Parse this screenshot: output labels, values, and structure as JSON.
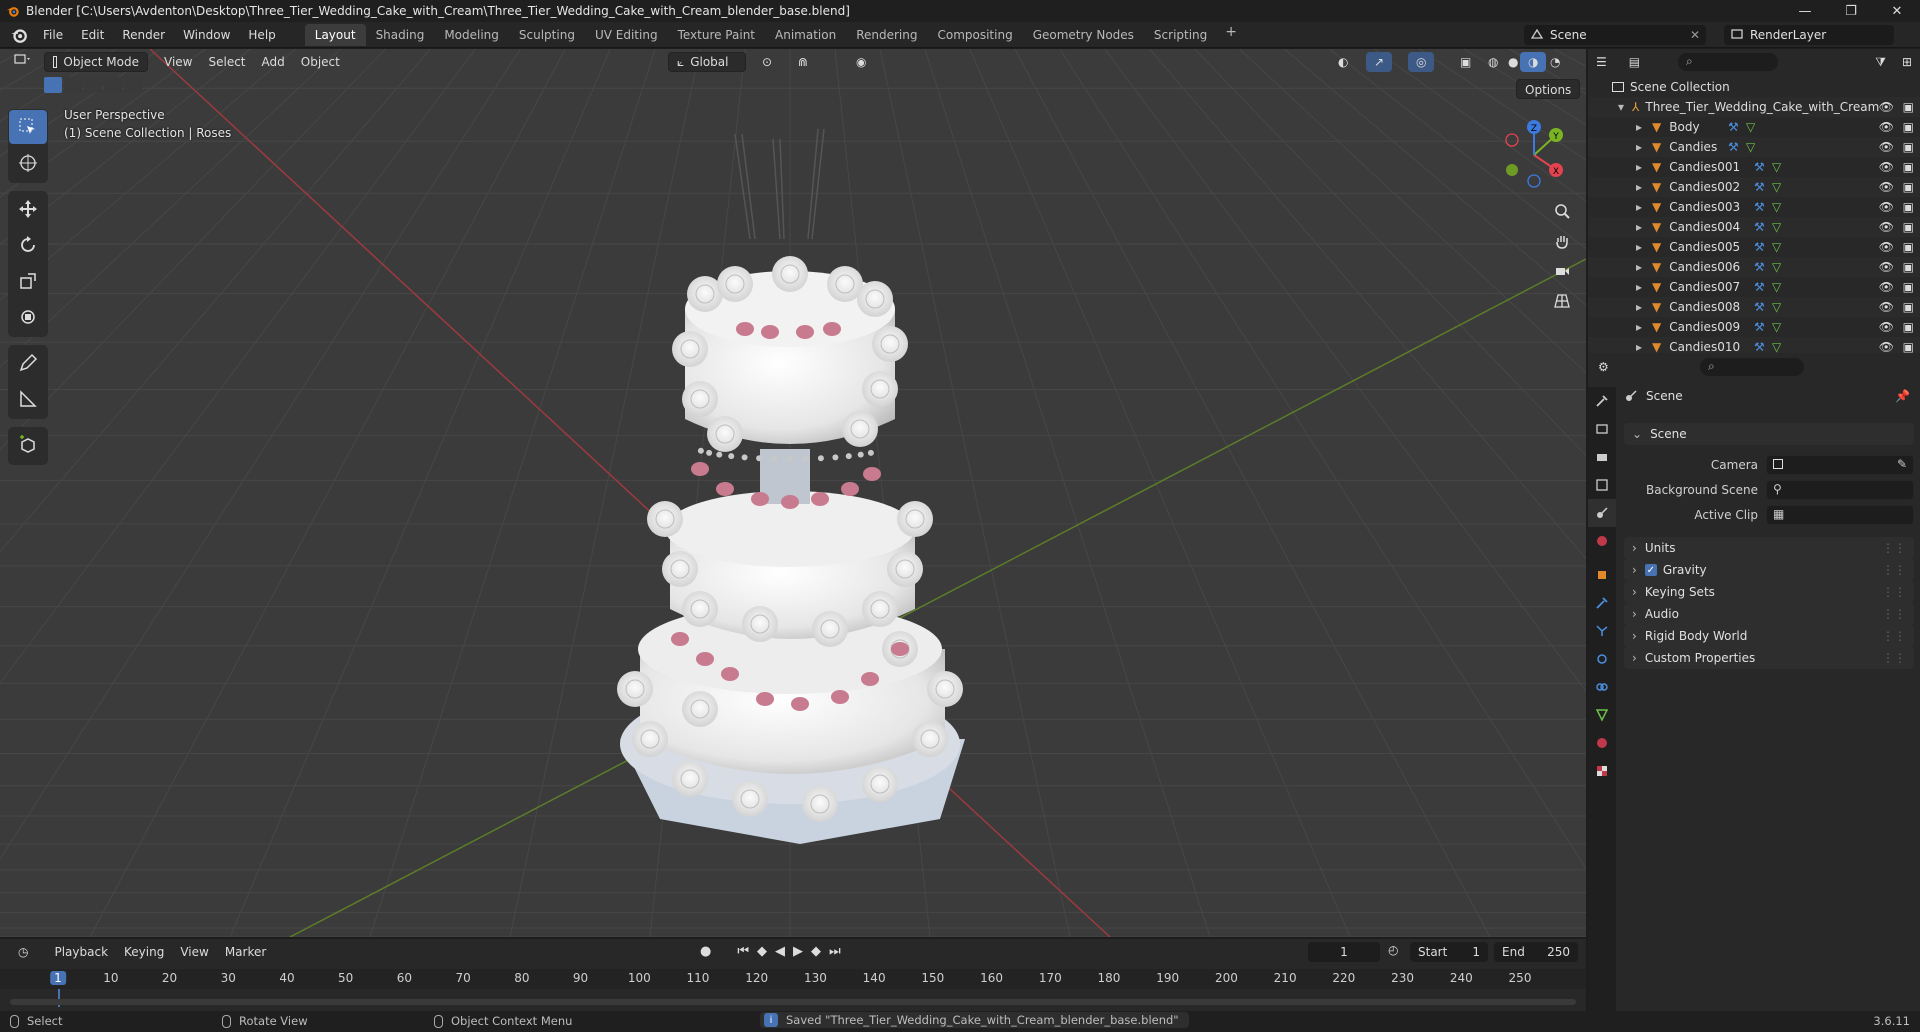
{
  "window": {
    "title": "Blender [C:\\Users\\Avdenton\\Desktop\\Three_Tier_Wedding_Cake_with_Cream\\Three_Tier_Wedding_Cake_with_Cream_blender_base.blend]",
    "controls": [
      "—",
      "❐",
      "✕"
    ]
  },
  "menu": [
    "File",
    "Edit",
    "Render",
    "Window",
    "Help"
  ],
  "workspaces": {
    "tabs": [
      "Layout",
      "Shading",
      "Modeling",
      "Sculpting",
      "UV Editing",
      "Texture Paint",
      "Animation",
      "Rendering",
      "Compositing",
      "Geometry Nodes",
      "Scripting"
    ],
    "active": "Layout",
    "add": "+"
  },
  "scene_selector": {
    "scene": "Scene",
    "view_layer": "RenderLayer"
  },
  "viewport": {
    "mode": "Object Mode",
    "menus": [
      "View",
      "Select",
      "Add",
      "Object"
    ],
    "orientation": "Global",
    "options_label": "Options",
    "overlay_line1": "User Perspective",
    "overlay_line2": "(1) Scene Collection | Roses",
    "gizmo_axes": {
      "x": "X",
      "y": "Y",
      "z": "Z"
    },
    "colors": {
      "x_axis": "#e2434f",
      "y_axis": "#7bb422",
      "z_axis": "#3d7ae0",
      "active_tool": "#4772b3"
    }
  },
  "outliner": {
    "root": "Scene Collection",
    "collection": "Three_Tier_Wedding_Cake_with_Cream",
    "objects": [
      "Body",
      "Candies",
      "Candies001",
      "Candies002",
      "Candies003",
      "Candies004",
      "Candies005",
      "Candies006",
      "Candies007",
      "Candies008",
      "Candies009",
      "Candies010"
    ]
  },
  "properties": {
    "context_title": "Scene",
    "panel_scene": "Scene",
    "fields": [
      {
        "label": "Camera",
        "value": ""
      },
      {
        "label": "Background Scene",
        "value": ""
      },
      {
        "label": "Active Clip",
        "value": ""
      }
    ],
    "panels": [
      "Units",
      "Gravity",
      "Keying Sets",
      "Audio",
      "Rigid Body World",
      "Custom Properties"
    ],
    "gravity_enabled": true
  },
  "timeline": {
    "menus": [
      "Playback",
      "Keying",
      "View",
      "Marker"
    ],
    "current_frame": "1",
    "start_label": "Start",
    "start": "1",
    "end_label": "End",
    "end": "250",
    "ruler": [
      "1",
      "10",
      "20",
      "30",
      "40",
      "50",
      "60",
      "70",
      "80",
      "90",
      "100",
      "110",
      "120",
      "130",
      "140",
      "150",
      "160",
      "170",
      "180",
      "190",
      "200",
      "210",
      "220",
      "230",
      "240",
      "250"
    ]
  },
  "statusbar": {
    "select": "Select",
    "rotate": "Rotate View",
    "context_menu": "Object Context Menu",
    "message": "Saved \"Three_Tier_Wedding_Cake_with_Cream_blender_base.blend\"",
    "version": "3.6.11"
  }
}
